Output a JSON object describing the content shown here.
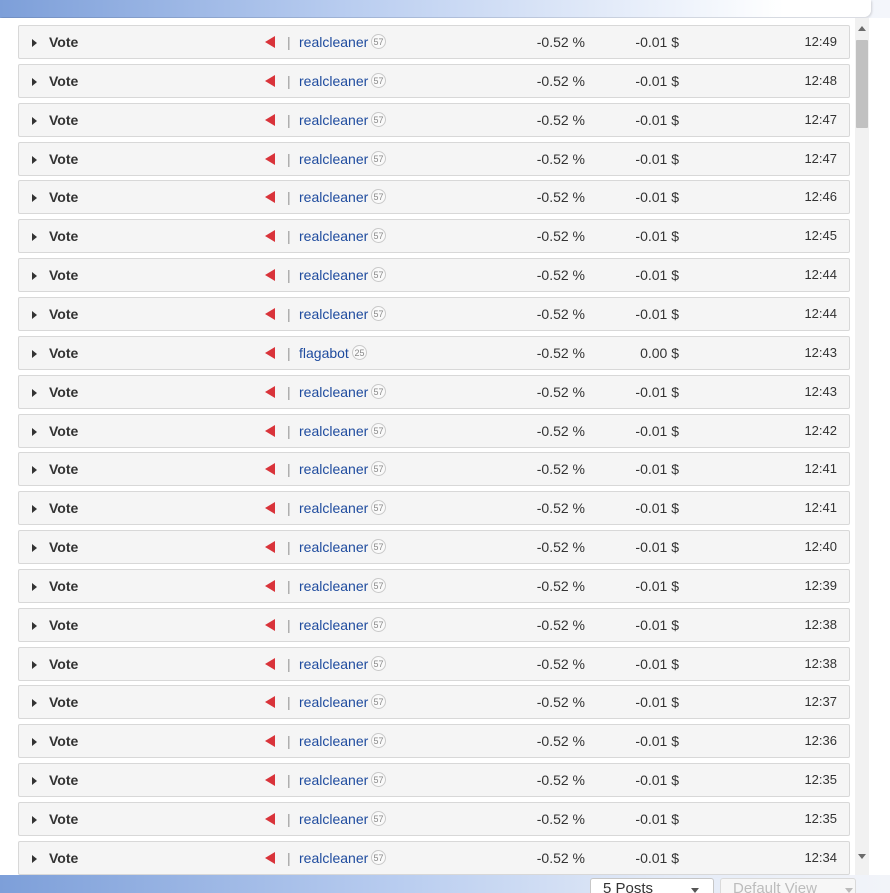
{
  "rows": [
    {
      "type": "Vote",
      "user": "realcleaner",
      "rep": "57",
      "percent": "-0.52 %",
      "value": "-0.01 $",
      "time": "12:49"
    },
    {
      "type": "Vote",
      "user": "realcleaner",
      "rep": "57",
      "percent": "-0.52 %",
      "value": "-0.01 $",
      "time": "12:48"
    },
    {
      "type": "Vote",
      "user": "realcleaner",
      "rep": "57",
      "percent": "-0.52 %",
      "value": "-0.01 $",
      "time": "12:47"
    },
    {
      "type": "Vote",
      "user": "realcleaner",
      "rep": "57",
      "percent": "-0.52 %",
      "value": "-0.01 $",
      "time": "12:47"
    },
    {
      "type": "Vote",
      "user": "realcleaner",
      "rep": "57",
      "percent": "-0.52 %",
      "value": "-0.01 $",
      "time": "12:46"
    },
    {
      "type": "Vote",
      "user": "realcleaner",
      "rep": "57",
      "percent": "-0.52 %",
      "value": "-0.01 $",
      "time": "12:45"
    },
    {
      "type": "Vote",
      "user": "realcleaner",
      "rep": "57",
      "percent": "-0.52 %",
      "value": "-0.01 $",
      "time": "12:44"
    },
    {
      "type": "Vote",
      "user": "realcleaner",
      "rep": "57",
      "percent": "-0.52 %",
      "value": "-0.01 $",
      "time": "12:44"
    },
    {
      "type": "Vote",
      "user": "flagabot",
      "rep": "25",
      "percent": "-0.52 %",
      "value": "0.00 $",
      "time": "12:43"
    },
    {
      "type": "Vote",
      "user": "realcleaner",
      "rep": "57",
      "percent": "-0.52 %",
      "value": "-0.01 $",
      "time": "12:43"
    },
    {
      "type": "Vote",
      "user": "realcleaner",
      "rep": "57",
      "percent": "-0.52 %",
      "value": "-0.01 $",
      "time": "12:42"
    },
    {
      "type": "Vote",
      "user": "realcleaner",
      "rep": "57",
      "percent": "-0.52 %",
      "value": "-0.01 $",
      "time": "12:41"
    },
    {
      "type": "Vote",
      "user": "realcleaner",
      "rep": "57",
      "percent": "-0.52 %",
      "value": "-0.01 $",
      "time": "12:41"
    },
    {
      "type": "Vote",
      "user": "realcleaner",
      "rep": "57",
      "percent": "-0.52 %",
      "value": "-0.01 $",
      "time": "12:40"
    },
    {
      "type": "Vote",
      "user": "realcleaner",
      "rep": "57",
      "percent": "-0.52 %",
      "value": "-0.01 $",
      "time": "12:39"
    },
    {
      "type": "Vote",
      "user": "realcleaner",
      "rep": "57",
      "percent": "-0.52 %",
      "value": "-0.01 $",
      "time": "12:38"
    },
    {
      "type": "Vote",
      "user": "realcleaner",
      "rep": "57",
      "percent": "-0.52 %",
      "value": "-0.01 $",
      "time": "12:38"
    },
    {
      "type": "Vote",
      "user": "realcleaner",
      "rep": "57",
      "percent": "-0.52 %",
      "value": "-0.01 $",
      "time": "12:37"
    },
    {
      "type": "Vote",
      "user": "realcleaner",
      "rep": "57",
      "percent": "-0.52 %",
      "value": "-0.01 $",
      "time": "12:36"
    },
    {
      "type": "Vote",
      "user": "realcleaner",
      "rep": "57",
      "percent": "-0.52 %",
      "value": "-0.01 $",
      "time": "12:35"
    },
    {
      "type": "Vote",
      "user": "realcleaner",
      "rep": "57",
      "percent": "-0.52 %",
      "value": "-0.01 $",
      "time": "12:35"
    },
    {
      "type": "Vote",
      "user": "realcleaner",
      "rep": "57",
      "percent": "-0.52 %",
      "value": "-0.01 $",
      "time": "12:34"
    }
  ],
  "separator": "|",
  "vote_icon": "downvote-triangle-icon",
  "vote_icon_color": "#d9333a",
  "link_color": "#1e4b9e",
  "footer": {
    "posts_select": "5 Posts",
    "view_select": "Default View"
  }
}
